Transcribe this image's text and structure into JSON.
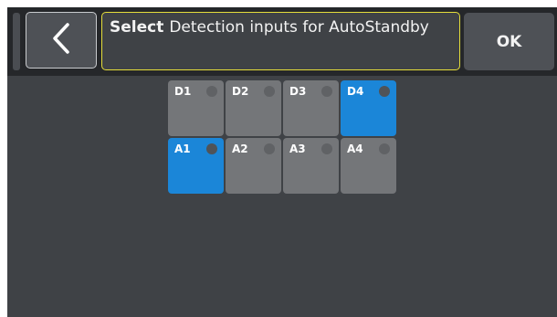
{
  "header": {
    "title_action": "Select",
    "title_text": "Detection inputs for AutoStandby",
    "ok_label": "OK",
    "back_icon": "chevron-left-icon"
  },
  "inputs": [
    {
      "label": "D1",
      "selected": false
    },
    {
      "label": "D2",
      "selected": false
    },
    {
      "label": "D3",
      "selected": false
    },
    {
      "label": "D4",
      "selected": true
    },
    {
      "label": "A1",
      "selected": true
    },
    {
      "label": "A2",
      "selected": false
    },
    {
      "label": "A3",
      "selected": false
    },
    {
      "label": "A4",
      "selected": false
    }
  ],
  "colors": {
    "selected": "#1b86d8",
    "unselected": "#747679",
    "title_border": "#e5de3a",
    "background": "#3f4246",
    "header": "#25272a"
  }
}
